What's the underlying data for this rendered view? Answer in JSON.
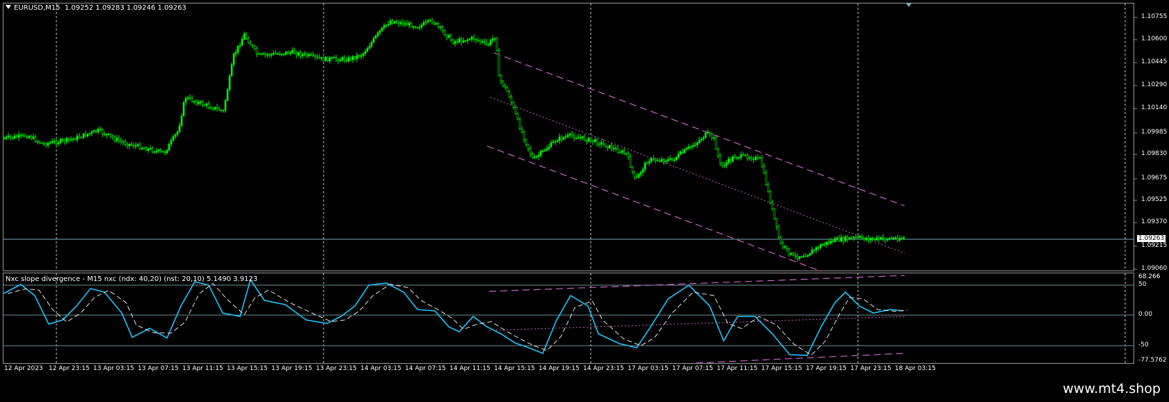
{
  "main": {
    "symbol": "EURUSD,M15",
    "ohlc": "1.09252 1.09283 1.09246 1.09263",
    "price_labels": [
      "1.10755",
      "1.10600",
      "1.10445",
      "1.10290",
      "1.10140",
      "1.09985",
      "1.09830",
      "1.09675",
      "1.09525",
      "1.09370",
      "1.09215",
      "1.09060"
    ],
    "current_price": "1.09263",
    "candle_color": "#00ff00",
    "channel_color": "#cc66cc"
  },
  "indicator": {
    "title": "Nxc slope divergence - M15 nxc (ndx: 40,20) (nst: 20,10) 5.1490 3.9123",
    "levels": [
      "68.266",
      "50",
      "0.00",
      "-50",
      "-77.5762"
    ],
    "line_color": "#1ec8ff"
  },
  "time_labels": [
    "12 Apr 2023",
    "12 Apr 23:15",
    "13 Apr 03:15",
    "13 Apr 07:15",
    "13 Apr 11:15",
    "13 Apr 15:15",
    "13 Apr 19:15",
    "13 Apr 23:15",
    "14 Apr 03:15",
    "14 Apr 07:15",
    "14 Apr 11:15",
    "14 Apr 15:15",
    "14 Apr 19:15",
    "14 Apr 23:15",
    "17 Apr 03:15",
    "17 Apr 07:15",
    "17 Apr 11:15",
    "17 Apr 15:15",
    "17 Apr 19:15",
    "17 Apr 23:15",
    "18 Apr 03:15"
  ],
  "watermark": "www.mt4.shop"
}
